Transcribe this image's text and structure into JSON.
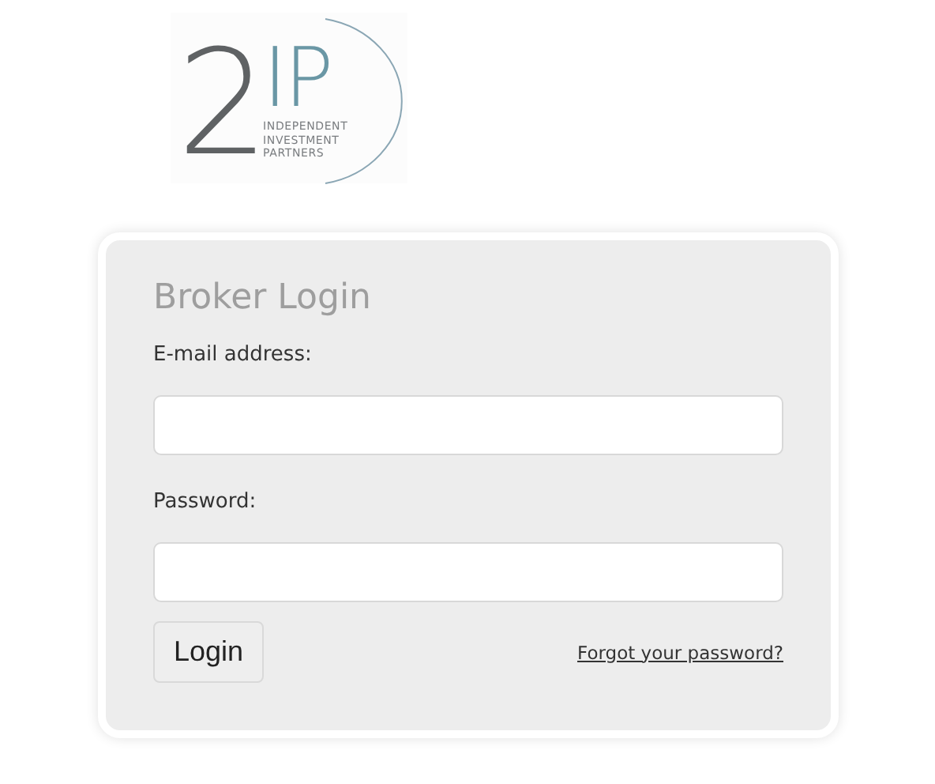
{
  "logo": {
    "numeral": "2",
    "letters": "IP",
    "tagline": [
      "INDEPENDENT",
      "INVESTMENT",
      "PARTNERS"
    ]
  },
  "login": {
    "title": "Broker Login",
    "fields": [
      {
        "label": "E-mail address:"
      },
      {
        "label": "Password:"
      }
    ],
    "button": "Login",
    "forgot_link": "Forgot your password?"
  }
}
